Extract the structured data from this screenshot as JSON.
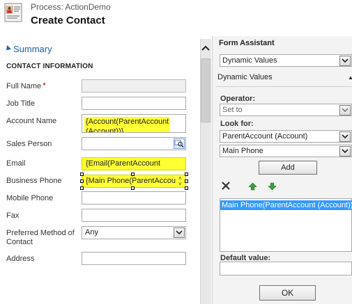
{
  "header": {
    "process_line": "Process: ActionDemo",
    "page_title": "Create Contact",
    "icon": "contact-card-icon"
  },
  "form": {
    "summary_label": "Summary",
    "section_title": "CONTACT INFORMATION",
    "fields": {
      "full_name": {
        "label": "Full Name",
        "required_mark": "*",
        "value": ""
      },
      "job_title": {
        "label": "Job Title",
        "value": ""
      },
      "account_name": {
        "label": "Account Name",
        "value_line1": "{Account(ParentAccount",
        "value_line2": "(Account))}"
      },
      "sales_person": {
        "label": "Sales Person",
        "value": ""
      },
      "email": {
        "label": "Email",
        "value": "{Email(ParentAccount"
      },
      "business_phone": {
        "label": "Business Phone",
        "value": "{Main Phone(ParentAccou"
      },
      "mobile_phone": {
        "label": "Mobile Phone",
        "value": ""
      },
      "fax": {
        "label": "Fax",
        "value": ""
      },
      "preferred_method": {
        "label_line1": "Preferred Method of",
        "label_line2": "Contact",
        "value": "Any"
      },
      "address": {
        "label": "Address",
        "value": ""
      }
    }
  },
  "form_assistant": {
    "title": "Form Assistant",
    "top_select_value": "Dynamic Values",
    "subheader": "Dynamic Values",
    "operator_label": "Operator:",
    "operator_value": "Set to",
    "look_for_label": "Look for:",
    "look_for_entity": "ParentAccount (Account)",
    "look_for_field": "Main Phone",
    "add_label": "Add",
    "selected_value": "Main Phone(ParentAccount (Account))",
    "default_value_label": "Default value:",
    "default_value": "",
    "ok_label": "OK"
  },
  "colors": {
    "dynamic_value_highlight": "#ffff33",
    "selection_blue": "#3399ff",
    "link_blue": "#1e5fa8",
    "required_red": "#cc0000"
  }
}
